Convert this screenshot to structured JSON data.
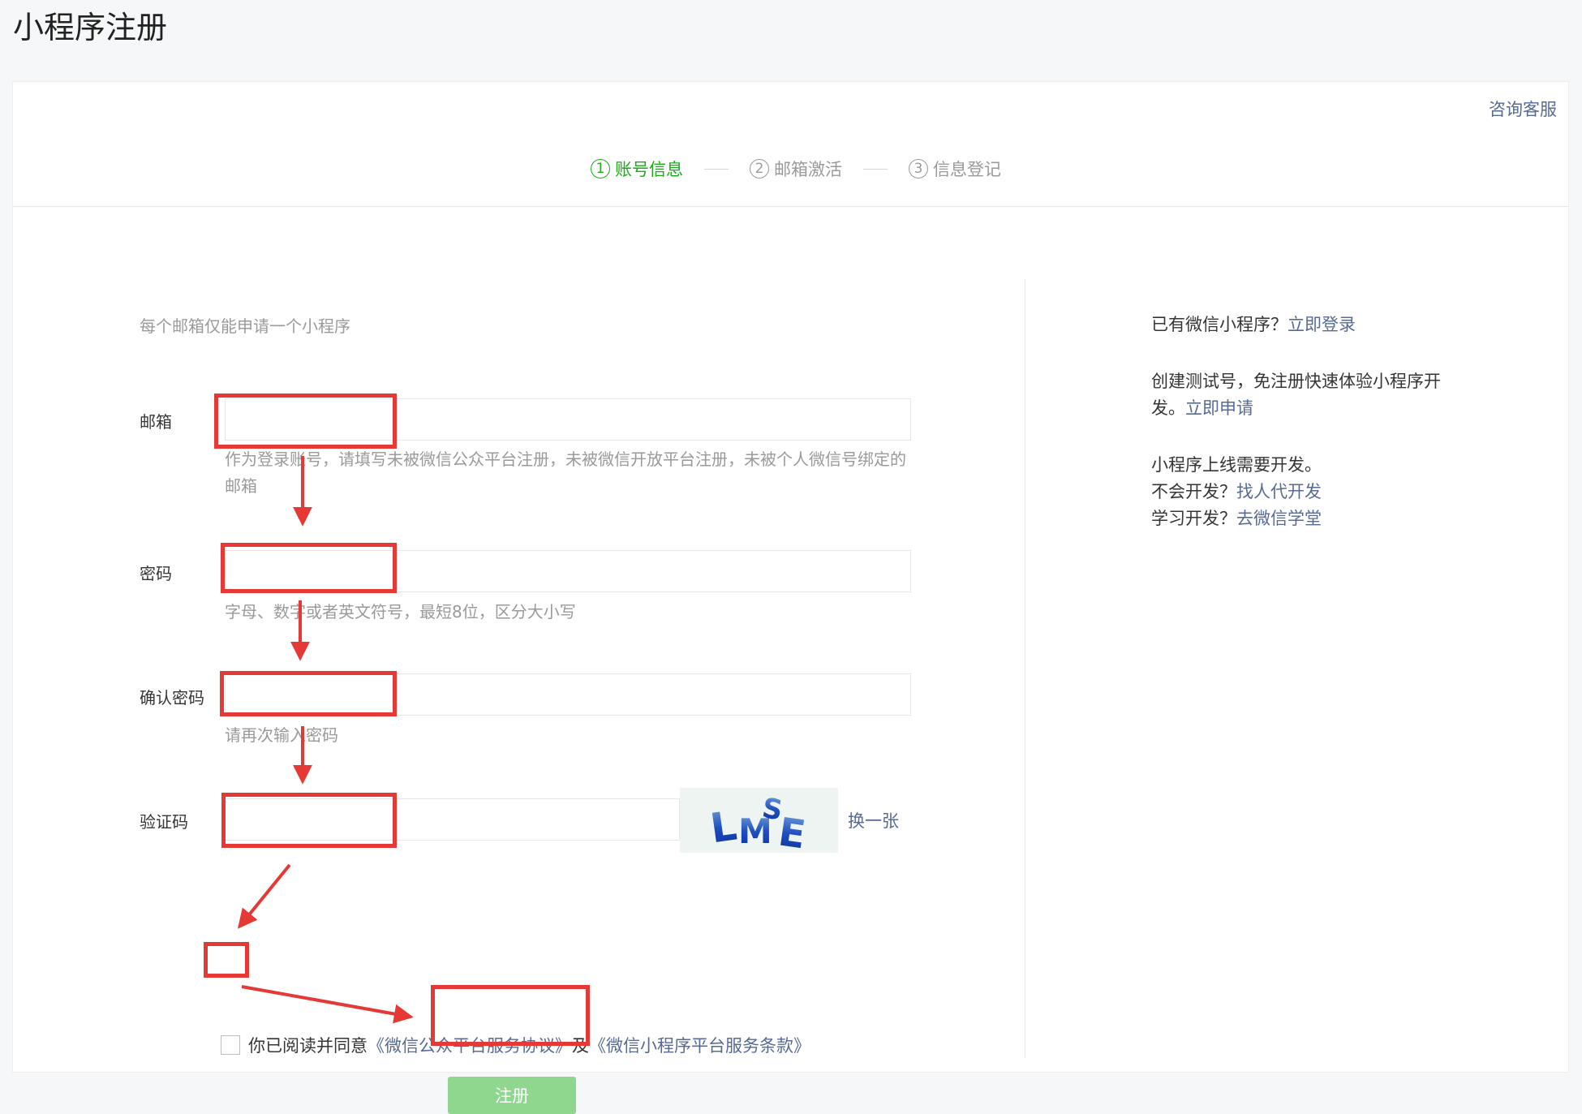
{
  "page": {
    "title": "小程序注册"
  },
  "header": {
    "consult_link": "咨询客服"
  },
  "steps": [
    {
      "num": "1",
      "label": "账号信息"
    },
    {
      "num": "2",
      "label": "邮箱激活"
    },
    {
      "num": "3",
      "label": "信息登记"
    }
  ],
  "form": {
    "tip": "每个邮箱仅能申请一个小程序",
    "email": {
      "label": "邮箱",
      "value": "",
      "hint": "作为登录账号，请填写未被微信公众平台注册，未被微信开放平台注册，未被个人微信号绑定的邮箱"
    },
    "password": {
      "label": "密码",
      "value": "",
      "hint": "字母、数字或者英文符号，最短8位，区分大小写"
    },
    "confirm_password": {
      "label": "确认密码",
      "value": "",
      "hint": "请再次输入密码"
    },
    "captcha": {
      "label": "验证码",
      "value": "",
      "image_text": "LMSE",
      "change_label": "换一张"
    },
    "agree": {
      "checked": false,
      "text": "你已阅读并同意",
      "link1": "《微信公众平台服务协议》",
      "conjunction": "及",
      "link2": "《微信小程序平台服务条款》"
    },
    "submit_label": "注册"
  },
  "sidebar": {
    "login_text": "已有微信小程序？",
    "login_link": "立即登录",
    "test_text": "创建测试号，免注册快速体验小程序开发。",
    "test_link": "立即申请",
    "dev_text": "小程序上线需要开发。",
    "no_dev_text": "不会开发？",
    "no_dev_link": "找人代开发",
    "learn_text": "学习开发？",
    "learn_link": "去微信学堂"
  },
  "colors": {
    "accent_green": "#1aad19",
    "link_blue": "#576b95",
    "button_disabled": "#8fd68f",
    "annotation_red": "#e53935"
  }
}
